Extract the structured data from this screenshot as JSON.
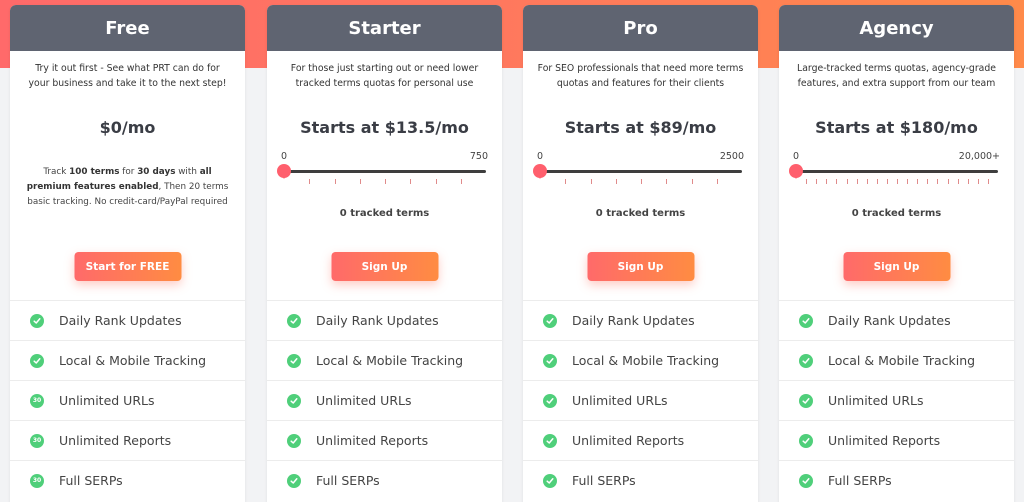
{
  "plans": [
    {
      "name": "Free",
      "description": "Try it out first - See what PRT can do for your business and take it to the next step!",
      "price": "$0/mo",
      "note_parts": [
        "Track ",
        "100 terms",
        " for ",
        "30 days",
        " with ",
        "all premium features enabled",
        ", Then 20 terms basic tracking. No credit-card/PayPal required"
      ],
      "cta": "Start for FREE",
      "features": [
        {
          "label": "Daily Rank Updates",
          "badge": ""
        },
        {
          "label": "Local & Mobile Tracking",
          "badge": ""
        },
        {
          "label": "Unlimited URLs",
          "badge": "30"
        },
        {
          "label": "Unlimited Reports",
          "badge": "30"
        },
        {
          "label": "Full SERPs",
          "badge": "30"
        }
      ]
    },
    {
      "name": "Starter",
      "description": "For those just starting out or need lower tracked terms quotas for personal use",
      "price": "Starts at $13.5/mo",
      "slider": {
        "min_label": "0",
        "max_label": "750",
        "value": 0,
        "ticks": 7
      },
      "tracked": "0 tracked terms",
      "cta": "Sign Up",
      "features": [
        {
          "label": "Daily Rank Updates",
          "badge": ""
        },
        {
          "label": "Local & Mobile Tracking",
          "badge": ""
        },
        {
          "label": "Unlimited URLs",
          "badge": ""
        },
        {
          "label": "Unlimited Reports",
          "badge": ""
        },
        {
          "label": "Full SERPs",
          "badge": ""
        }
      ]
    },
    {
      "name": "Pro",
      "description": "For SEO professionals that need more terms quotas and features for their clients",
      "price": "Starts at $89/mo",
      "slider": {
        "min_label": "0",
        "max_label": "2500",
        "value": 0,
        "ticks": 7
      },
      "tracked": "0 tracked terms",
      "cta": "Sign Up",
      "features": [
        {
          "label": "Daily Rank Updates",
          "badge": ""
        },
        {
          "label": "Local & Mobile Tracking",
          "badge": ""
        },
        {
          "label": "Unlimited URLs",
          "badge": ""
        },
        {
          "label": "Unlimited Reports",
          "badge": ""
        },
        {
          "label": "Full SERPs",
          "badge": ""
        }
      ]
    },
    {
      "name": "Agency",
      "description": "Large-tracked terms quotas, agency-grade features, and extra support from our team",
      "price": "Starts at $180/mo",
      "slider": {
        "min_label": "0",
        "max_label": "20,000+",
        "value": 0,
        "ticks": 19
      },
      "tracked": "0 tracked terms",
      "cta": "Sign Up",
      "features": [
        {
          "label": "Daily Rank Updates",
          "badge": ""
        },
        {
          "label": "Local & Mobile Tracking",
          "badge": ""
        },
        {
          "label": "Unlimited URLs",
          "badge": ""
        },
        {
          "label": "Unlimited Reports",
          "badge": ""
        },
        {
          "label": "Full SERPs",
          "badge": ""
        }
      ]
    }
  ],
  "icons": {
    "feature": "check-circle-icon"
  },
  "colors": {
    "header": "#5f6471",
    "accent_start": "#ff6a6a",
    "accent_end": "#ff8c42",
    "check": "#4fcf7a"
  }
}
